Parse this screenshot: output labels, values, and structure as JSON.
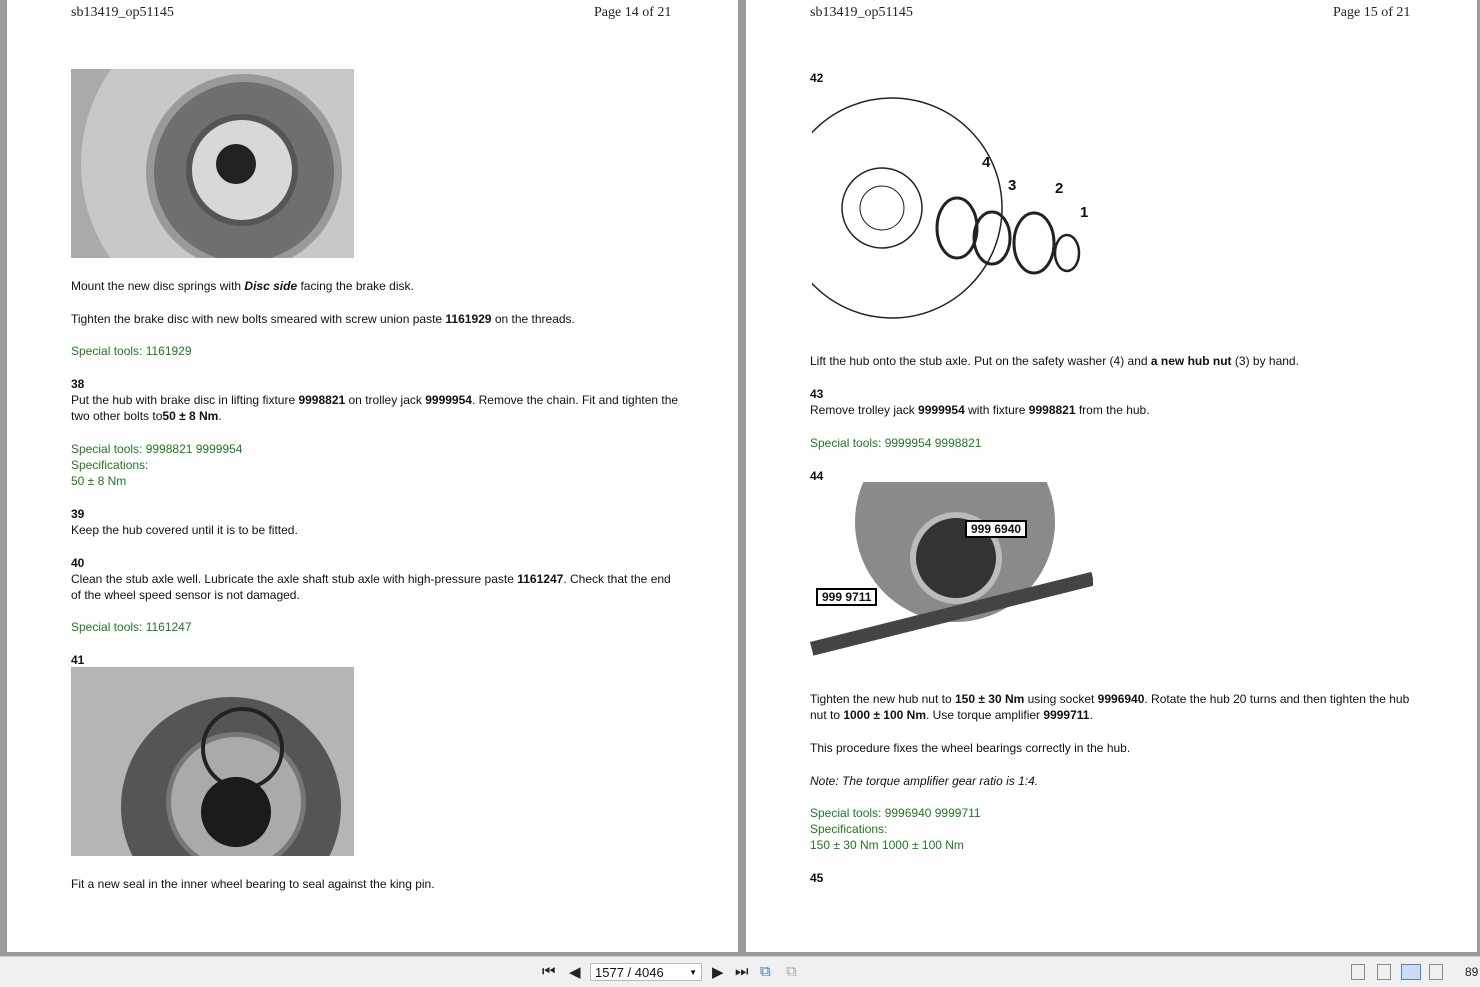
{
  "left_page": {
    "doc_id": "sb13419_op51145",
    "page_label": "Page 14 of 21",
    "p1_pre": "Mount the new disc springs with ",
    "p1_em": "Disc side",
    "p1_post": " facing the brake disk.",
    "p2_pre": "Tighten the brake disc with new bolts smeared with screw union paste ",
    "p2_b": "1161929",
    "p2_post": " on the threads.",
    "tools1": "Special tools: 1161929",
    "s38": "38",
    "s38_l1a": "Put the hub with brake disc in lifting fixture ",
    "s38_b1": "9998821",
    "s38_l1b": " on trolley jack ",
    "s38_b2": "9999954",
    "s38_l1c": ". Remove the chain. Fit and tighten the",
    "s38_l2a": "two other bolts to",
    "s38_b3": "50 ± 8 Nm",
    "s38_l2b": ".",
    "tools38": "Special tools: 9998821 9999954",
    "spec38_label": "Specifications:",
    "spec38": "50 ± 8 Nm",
    "s39": "39",
    "s39_text": "Keep the hub covered until it is to be fitted.",
    "s40": "40",
    "s40_l1a": "Clean the stub axle well. Lubricate the axle shaft stub axle with high-pressure paste ",
    "s40_b": "1161247",
    "s40_l1b": ". Check that the end",
    "s40_l2": "of the wheel speed sensor is not damaged.",
    "tools40": "Special tools: 1161247",
    "s41": "41",
    "s41_text": "Fit a new seal in the inner wheel bearing to seal against the king pin."
  },
  "right_page": {
    "doc_id": "sb13419_op51145",
    "page_label": "Page 15 of 21",
    "s42": "42",
    "callouts": [
      "4",
      "3",
      "2",
      "1"
    ],
    "s42_a": "Lift the hub onto the stub axle. Put on the safety washer (4) and ",
    "s42_b": "a new hub nut",
    "s42_c": " (3) by hand.",
    "s43": "43",
    "s43_a": "Remove trolley jack ",
    "s43_b1": "9999954",
    "s43_m": " with fixture ",
    "s43_b2": "9998821",
    "s43_c": " from the hub.",
    "tools43": "Special tools: 9999954 9998821",
    "s44": "44",
    "label1": "999 6940",
    "label2": "999 9711",
    "s44_l1a": "Tighten the new hub nut to ",
    "s44_b1": "150 ± 30 Nm",
    "s44_l1b": " using socket ",
    "s44_b2": "9996940",
    "s44_l1c": ". Rotate the hub 20 turns and then tighten the hub",
    "s44_l2a": "nut to ",
    "s44_b3": "1000 ± 100 Nm",
    "s44_l2b": ". Use torque amplifier ",
    "s44_b4": "9999711",
    "s44_l2c": ".",
    "s44_p2": "This procedure fixes the wheel bearings correctly in the hub.",
    "note": "Note: The torque amplifier gear ratio is 1:4.",
    "tools44": "Special tools: 9996940 9999711",
    "spec44_label": "Specifications:",
    "spec44": "150 ± 30 Nm 1000 ± 100 Nm",
    "s45": "45"
  },
  "toolbar": {
    "page_field": "1577 / 4046",
    "zoom": "89"
  }
}
